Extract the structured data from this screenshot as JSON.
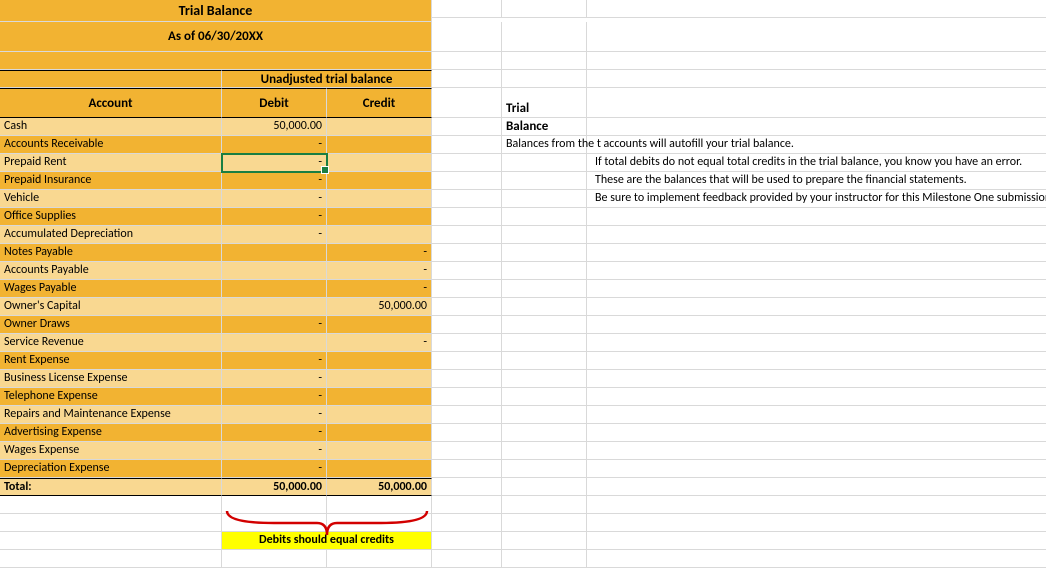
{
  "header": {
    "title": "Trial Balance",
    "asof": "As of 06/30/20XX",
    "section": "Unadjusted trial balance",
    "col_account": "Account",
    "col_debit": "Debit",
    "col_credit": "Credit"
  },
  "rows": [
    {
      "acct": "Cash",
      "debit": "50,000.00",
      "credit": ""
    },
    {
      "acct": "Accounts Receivable",
      "debit": "-",
      "credit": ""
    },
    {
      "acct": "Prepaid Rent",
      "debit": "-",
      "credit": ""
    },
    {
      "acct": "Prepaid Insurance",
      "debit": "-",
      "credit": ""
    },
    {
      "acct": "Vehicle",
      "debit": "-",
      "credit": ""
    },
    {
      "acct": "Office Supplies",
      "debit": "-",
      "credit": ""
    },
    {
      "acct": "Accumulated Depreciation",
      "debit": "-",
      "credit": ""
    },
    {
      "acct": "Notes Payable",
      "debit": "",
      "credit": "-"
    },
    {
      "acct": "Accounts Payable",
      "debit": "",
      "credit": "-"
    },
    {
      "acct": "Wages Payable",
      "debit": "",
      "credit": "-"
    },
    {
      "acct": "Owner's Capital",
      "debit": "",
      "credit": "50,000.00"
    },
    {
      "acct": "Owner Draws",
      "debit": "-",
      "credit": ""
    },
    {
      "acct": "Service Revenue",
      "debit": "",
      "credit": "-"
    },
    {
      "acct": "Rent Expense",
      "debit": "-",
      "credit": ""
    },
    {
      "acct": "Business License Expense",
      "debit": "-",
      "credit": ""
    },
    {
      "acct": "Telephone Expense",
      "debit": "-",
      "credit": ""
    },
    {
      "acct": "Repairs and Maintenance Expense",
      "debit": "-",
      "credit": ""
    },
    {
      "acct": "Advertising Expense",
      "debit": "-",
      "credit": ""
    },
    {
      "acct": "Wages Expense",
      "debit": "-",
      "credit": ""
    },
    {
      "acct": "Depreciation Expense",
      "debit": "-",
      "credit": ""
    }
  ],
  "total": {
    "label": "Total:",
    "debit": "50,000.00",
    "credit": "50,000.00"
  },
  "brace_note": "Debits should equal credits",
  "side": {
    "title1": "Trial",
    "title2": "Balance",
    "line1": "Balances from the t accounts will autofill your trial balance.",
    "line2": "If total debits do not equal total credits in the trial balance, you know you have an error.",
    "line3": "These are the balances that will be used to prepare the financial statements.",
    "line4": "Be sure to implement feedback provided by your instructor for this Milestone One submission!"
  }
}
